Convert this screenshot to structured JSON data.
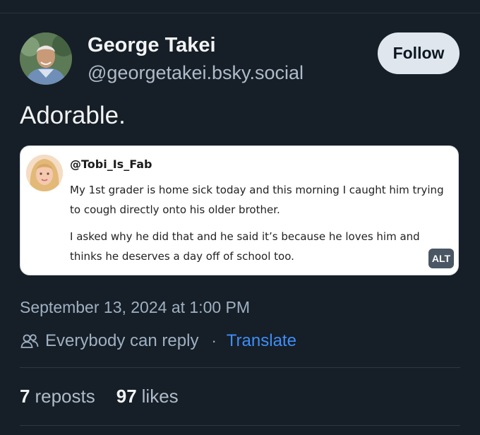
{
  "author": {
    "display_name": "George Takei",
    "handle": "@georgetakei.bsky.social"
  },
  "actions": {
    "follow_label": "Follow"
  },
  "post": {
    "text": "Adorable."
  },
  "embed": {
    "handle": "@Tobi_Is_Fab",
    "paragraphs": [
      "My 1st grader is home sick today and this morning I caught him trying to cough directly onto his older brother.",
      "I asked why he did that and he said it’s because he loves him and thinks he deserves a day off of school too."
    ],
    "alt_badge": "ALT"
  },
  "meta": {
    "timestamp": "September 13, 2024 at 1:00 PM",
    "reply_setting": "Everybody can reply",
    "separator": "·",
    "translate_label": "Translate"
  },
  "stats": {
    "reposts_count": "7",
    "reposts_label": "reposts",
    "likes_count": "97",
    "likes_label": "likes"
  },
  "colors": {
    "background": "#161e27",
    "link": "#3e8ef7",
    "follow_button_bg": "#dfe6ee"
  }
}
